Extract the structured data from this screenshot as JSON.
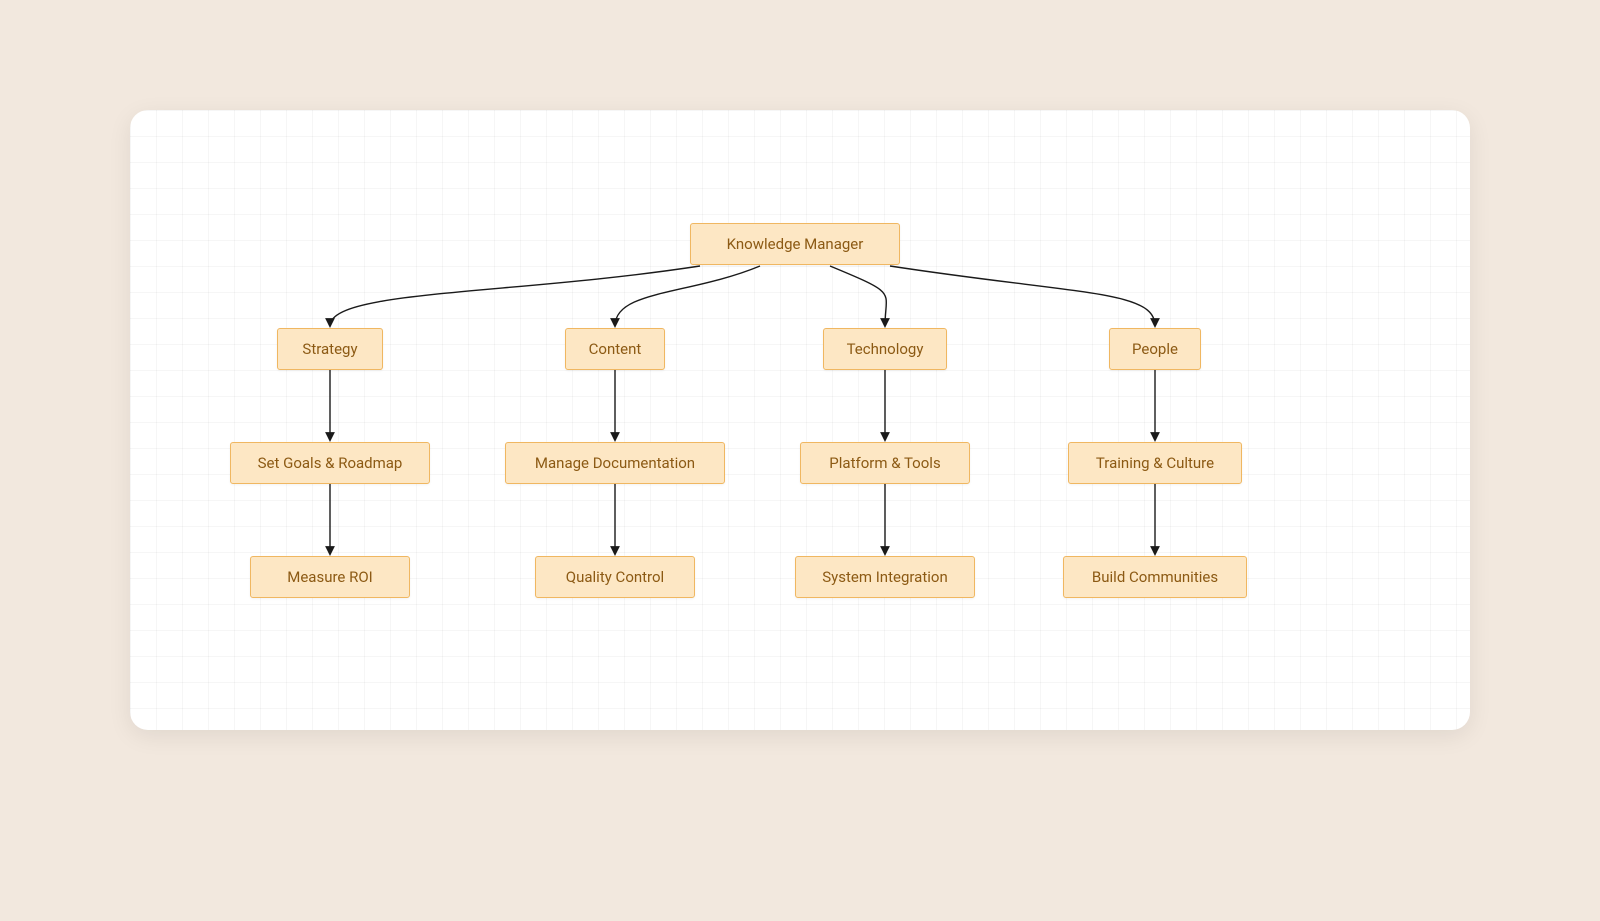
{
  "diagram": {
    "root": {
      "label": "Knowledge Manager"
    },
    "branches": [
      {
        "category": "Strategy",
        "items": [
          "Set Goals & Roadmap",
          "Measure ROI"
        ]
      },
      {
        "category": "Content",
        "items": [
          "Manage Documentation",
          "Quality Control"
        ]
      },
      {
        "category": "Technology",
        "items": [
          "Platform & Tools",
          "System Integration"
        ]
      },
      {
        "category": "People",
        "items": [
          "Training & Culture",
          "Build Communities"
        ]
      }
    ]
  },
  "colors": {
    "page_bg": "#f2e8de",
    "card_bg": "#ffffff",
    "node_fill": "#fde7c4",
    "node_border": "#f0b761",
    "node_text": "#8c5a14",
    "connector": "#1a1a1a"
  }
}
